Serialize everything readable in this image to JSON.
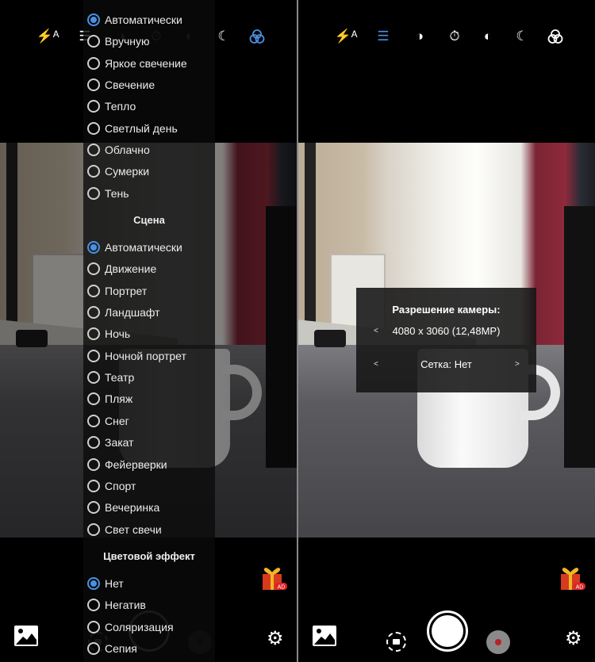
{
  "left_screen": {
    "toolbar": [
      "flash-auto-icon",
      "sliders-icon",
      "exposure-icon",
      "timer-icon",
      "brightness-icon",
      "night-mode-icon",
      "color-effect-icon"
    ],
    "active_tool": "color-effect-icon",
    "white_balance": {
      "options": [
        "Автоматически",
        "Вручную",
        "Яркое свечение",
        "Свечение",
        "Тепло",
        "Светлый день",
        "Облачно",
        "Сумерки",
        "Тень"
      ],
      "selected": 0
    },
    "scene": {
      "header": "Сцена",
      "options": [
        "Автоматически",
        "Движение",
        "Портрет",
        "Ландшафт",
        "Ночь",
        "Ночной портрет",
        "Театр",
        "Пляж",
        "Снег",
        "Закат",
        "Фейерверки",
        "Спорт",
        "Вечеринка",
        "Свет свечи"
      ],
      "selected": 0
    },
    "color_effect": {
      "header": "Цветовой эффект",
      "options": [
        "Нет",
        "Негатив",
        "Соляризация",
        "Сепия"
      ],
      "selected": 0
    }
  },
  "right_screen": {
    "toolbar": [
      "flash-auto-icon",
      "sliders-icon",
      "exposure-icon",
      "timer-icon",
      "brightness-icon",
      "night-mode-icon",
      "color-effect-icon"
    ],
    "active_tool": "sliders-icon",
    "popup": {
      "title": "Разрешение камеры:",
      "resolution": "4080 x 3060 (12,48MP)",
      "grid": "Сетка: Нет",
      "prev": "<",
      "next": ">"
    }
  },
  "ad_badge": "AD",
  "colors": {
    "accent": "#4a90e2",
    "record": "#b22222",
    "background": "#000000"
  }
}
